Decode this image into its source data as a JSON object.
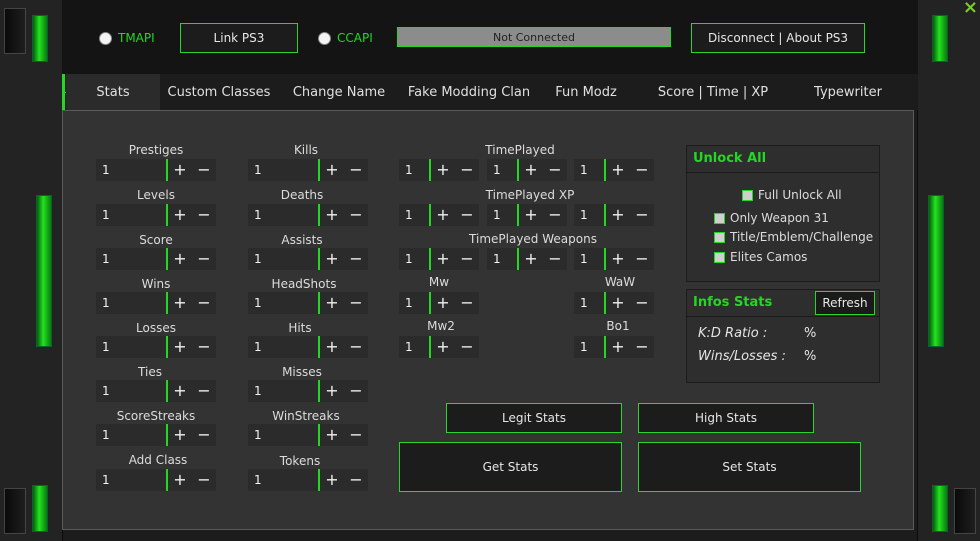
{
  "window": {
    "close_label": "×"
  },
  "header": {
    "tmapi_label": "TMAPI",
    "link_ps3_label": "Link PS3",
    "ccapi_label": "CCAPI",
    "status_text": "Not Connected",
    "disconnect_label": "Disconnect | About PS3"
  },
  "tabs": [
    {
      "label": "Stats"
    },
    {
      "label": "Custom Classes"
    },
    {
      "label": "Change Name"
    },
    {
      "label": "Fake Modding Clan"
    },
    {
      "label": "Fun Modz"
    },
    {
      "label": "Score | Time | XP"
    },
    {
      "label": "Typewriter"
    }
  ],
  "stats_left": [
    {
      "label": "Prestiges",
      "value": "1"
    },
    {
      "label": "Levels",
      "value": "1"
    },
    {
      "label": "Score",
      "value": "1"
    },
    {
      "label": "Wins",
      "value": "1"
    },
    {
      "label": "Losses",
      "value": "1"
    },
    {
      "label": "Ties",
      "value": "1"
    },
    {
      "label": "ScoreStreaks",
      "value": "1"
    },
    {
      "label": "Add Class",
      "value": "1"
    }
  ],
  "stats_mid": [
    {
      "label": "Kills",
      "value": "1"
    },
    {
      "label": "Deaths",
      "value": "1"
    },
    {
      "label": "Assists",
      "value": "1"
    },
    {
      "label": "HeadShots",
      "value": "1"
    },
    {
      "label": "Hits",
      "value": "1"
    },
    {
      "label": "Misses",
      "value": "1"
    },
    {
      "label": "WinStreaks",
      "value": "1"
    },
    {
      "label": "Tokens",
      "value": "1"
    }
  ],
  "time": {
    "timeplayed_label": "TimePlayed",
    "timeplayed_xp_label": "TimePlayed XP",
    "timeplayed_weapons_label": "TimePlayed Weapons",
    "rows": [
      [
        "1",
        "1",
        "1"
      ],
      [
        "1",
        "1",
        "1"
      ],
      [
        "1",
        "1",
        "1"
      ]
    ]
  },
  "games": {
    "mw_label": "Mw",
    "mw_value": "1",
    "waw_label": "WaW",
    "waw_value": "1",
    "mw2_label": "Mw2",
    "mw2_value": "1",
    "bo1_label": "Bo1",
    "bo1_value": "1"
  },
  "stepper": {
    "plus": "+",
    "minus": "−"
  },
  "unlock": {
    "title": "Unlock All",
    "full_unlock": "Full Unlock All",
    "only_weapon": "Only Weapon 31",
    "title_emblem": "Title/Emblem/Challenge",
    "elites_camos": "Elites Camos"
  },
  "infos": {
    "title": "Infos Stats",
    "refresh_label": "Refresh",
    "kd_label": "K:D Ratio :",
    "kd_value": "%",
    "wl_label": "Wins/Losses :",
    "wl_value": "%"
  },
  "actions": {
    "legit_label": "Legit Stats",
    "high_label": "High Stats",
    "get_label": "Get Stats",
    "set_label": "Set Stats"
  },
  "colors": {
    "accent": "#22d822",
    "background": "#333333"
  }
}
